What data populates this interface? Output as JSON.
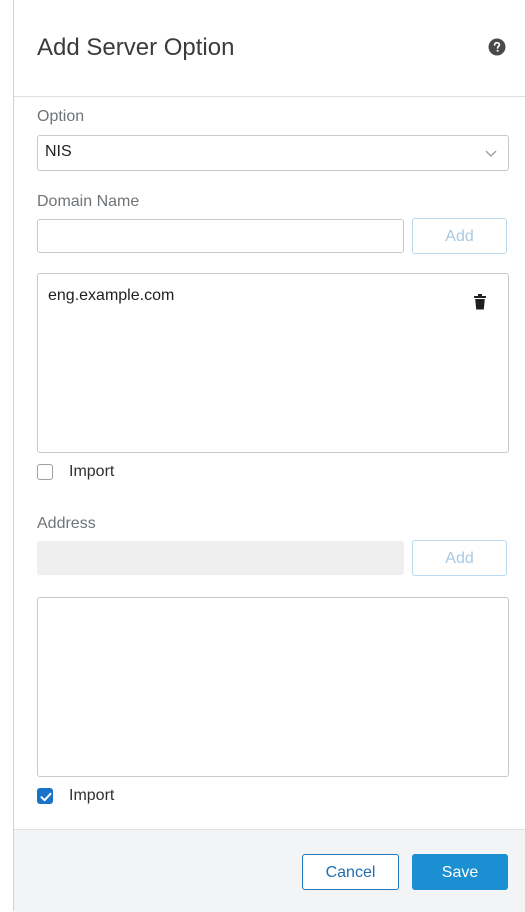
{
  "dialog": {
    "title": "Add Server Option",
    "help_icon": "question-circle-icon"
  },
  "option": {
    "label": "Option",
    "selected": "NIS",
    "icon": "chevron-down-icon"
  },
  "domain_name": {
    "label": "Domain Name",
    "value": "",
    "add_label": "Add",
    "items": [
      "eng.example.com"
    ],
    "item_icon": "trash-icon",
    "import_label": "Import",
    "import_checked": false
  },
  "address": {
    "label": "Address",
    "value": "",
    "disabled": true,
    "add_label": "Add",
    "items": [],
    "import_label": "Import",
    "import_checked": true
  },
  "footer": {
    "cancel_label": "Cancel",
    "save_label": "Save"
  },
  "colors": {
    "primary": "#1a8fd1",
    "checkbox_checked": "#1a73c8",
    "disabled_button_text": "#a8c9e3"
  }
}
